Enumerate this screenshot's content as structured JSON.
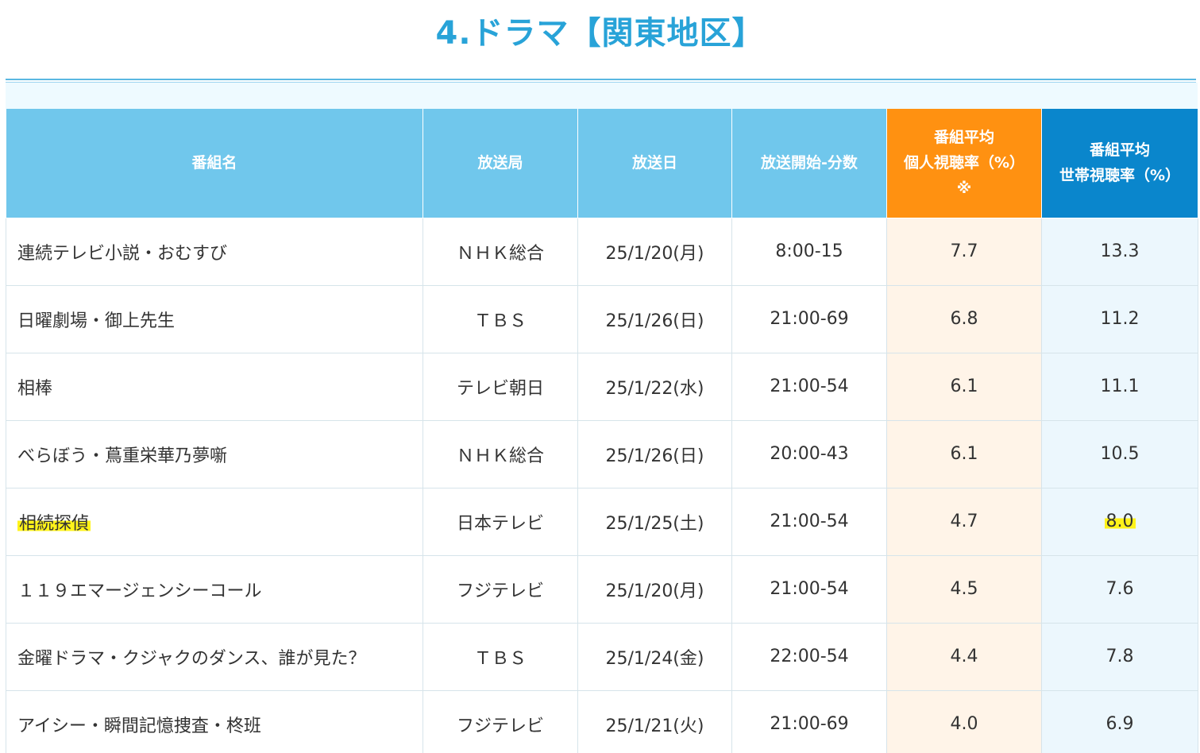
{
  "title": "4.ドラマ【関東地区】",
  "table": {
    "headers": {
      "name": "番組名",
      "station": "放送局",
      "date": "放送日",
      "start": "放送開始-分数",
      "personal_l1": "番組平均",
      "personal_l2": "個人視聴率（%）",
      "personal_l3": "※",
      "household_l1": "番組平均",
      "household_l2": "世帯視聴率（%）"
    },
    "rows": [
      {
        "name": "連続テレビ小説・おむすび",
        "station": "ＮＨＫ総合",
        "date": "25/1/20(月)",
        "start": "8:00-15",
        "personal": "7.7",
        "household": "13.3"
      },
      {
        "name": "日曜劇場・御上先生",
        "station": "ＴＢＳ",
        "date": "25/1/26(日)",
        "start": "21:00-69",
        "personal": "6.8",
        "household": "11.2"
      },
      {
        "name": "相棒",
        "station": "テレビ朝日",
        "date": "25/1/22(水)",
        "start": "21:00-54",
        "personal": "6.1",
        "household": "11.1"
      },
      {
        "name": "べらぼう・蔦重栄華乃夢噺",
        "station": "ＮＨＫ総合",
        "date": "25/1/26(日)",
        "start": "20:00-43",
        "personal": "6.1",
        "household": "10.5"
      },
      {
        "name": "相続探偵",
        "station": "日本テレビ",
        "date": "25/1/25(土)",
        "start": "21:00-54",
        "personal": "4.7",
        "household": "8.0"
      },
      {
        "name": "１１９エマージェンシーコール",
        "station": "フジテレビ",
        "date": "25/1/20(月)",
        "start": "21:00-54",
        "personal": "4.5",
        "household": "7.6"
      },
      {
        "name": "金曜ドラマ・クジャクのダンス、誰が見た？",
        "station": "ＴＢＳ",
        "date": "25/1/24(金)",
        "start": "22:00-54",
        "personal": "4.4",
        "household": "7.8"
      },
      {
        "name": "アイシー・瞬間記憶捜査・柊班",
        "station": "フジテレビ",
        "date": "25/1/21(火)",
        "start": "21:00-69",
        "personal": "4.0",
        "household": "6.9"
      }
    ]
  },
  "colors": {
    "title": "#28a3d8",
    "header_blue": "#70c7ec",
    "header_orange": "#ff9111",
    "header_dark_blue": "#0a86cc",
    "highlight": "#fff31a"
  }
}
